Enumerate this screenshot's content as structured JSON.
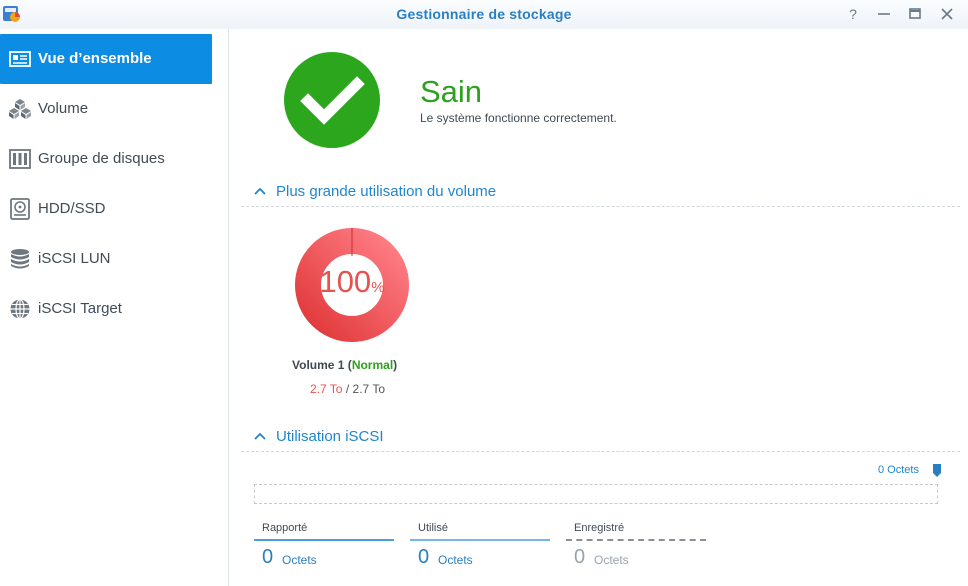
{
  "window": {
    "title": "Gestionnaire de stockage",
    "controls": {
      "help": "?",
      "minimize": "—",
      "maximize": "▭",
      "close": "✕"
    }
  },
  "sidebar": {
    "items": [
      {
        "label": "Vue d’ensemble",
        "icon": "overview-icon",
        "active": true
      },
      {
        "label": "Volume",
        "icon": "cubes-icon",
        "active": false
      },
      {
        "label": "Groupe de disques",
        "icon": "disk-group-icon",
        "active": false
      },
      {
        "label": "HDD/SSD",
        "icon": "hard-drive-icon",
        "active": false
      },
      {
        "label": "iSCSI LUN",
        "icon": "database-icon",
        "active": false
      },
      {
        "label": "iSCSI Target",
        "icon": "globe-icon",
        "active": false
      }
    ]
  },
  "status": {
    "title": "Sain",
    "description": "Le système fonctionne correctement.",
    "color": "#2ca61c"
  },
  "volume_section": {
    "heading": "Plus grande utilisation du volume",
    "usage_value": "100",
    "usage_unit": "%",
    "usage_fraction": 1.0,
    "volume_name": "Volume 1",
    "volume_state": "Normal",
    "used": "2.7 To",
    "separator": "/",
    "total": "2.7 To",
    "colors": {
      "ring_start": "#e0383a",
      "ring_end": "#ff7f86"
    }
  },
  "iscsi_section": {
    "heading": "Utilisation iSCSI",
    "total_label": "0 Octets",
    "stats": [
      {
        "label": "Rapporté",
        "value": "0",
        "unit": "Octets"
      },
      {
        "label": "Utilisé",
        "value": "0",
        "unit": "Octets"
      },
      {
        "label": "Enregistré",
        "value": "0",
        "unit": "Octets"
      }
    ]
  },
  "colors": {
    "accent": "#0d8ce4",
    "link": "#1f86cc",
    "healthy": "#2da11f",
    "warning": "#e8524e"
  }
}
